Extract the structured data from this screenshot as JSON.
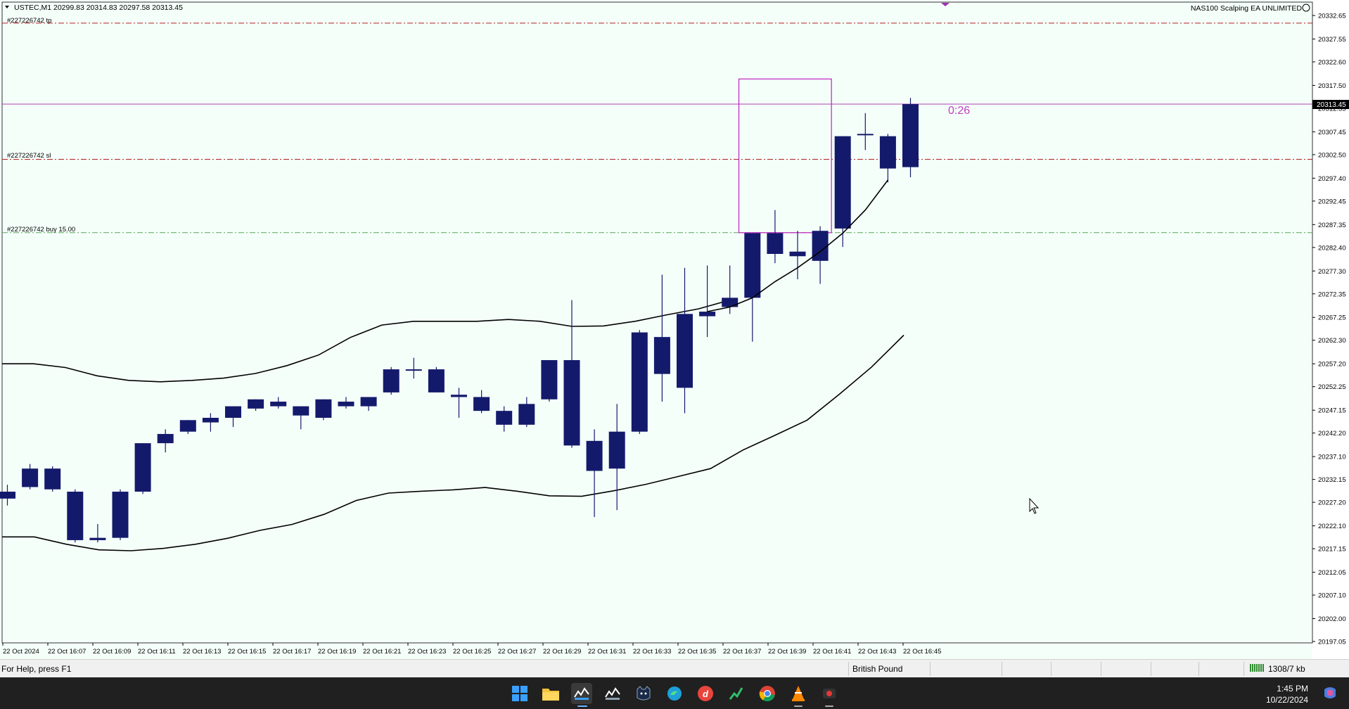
{
  "header": {
    "symbol_info": "USTEC,M1  20299.83 20314.83 20297.58 20313.45",
    "ea_name": "NAS100 Scalping EA UNLIMITED"
  },
  "trade_lines": {
    "tp_label": "#227226742 tp",
    "sl_label": "#227226742 sl",
    "buy_label": "#227226742 buy 15.00",
    "tp_price": 20331.0,
    "sl_price": 20301.5,
    "buy_price": 20285.6
  },
  "countdown": "0:26",
  "current_price": 20313.45,
  "current_price_label": "20313.45",
  "colors": {
    "candle": "#141a6b",
    "chart_bg": "#f5fffa",
    "sl_tp_line": "#b32020",
    "buy_line": "#5aa55a",
    "price_line": "#b040b0",
    "box": "#c020c0"
  },
  "price_axis": {
    "labels": [
      "20332.65",
      "20327.55",
      "20322.60",
      "20317.50",
      "20312.55",
      "20307.45",
      "20302.50",
      "20297.40",
      "20292.45",
      "20287.35",
      "20282.40",
      "20277.30",
      "20272.35",
      "20267.25",
      "20262.30",
      "20257.20",
      "20252.25",
      "20247.15",
      "20242.20",
      "20237.10",
      "20232.15",
      "20227.20",
      "20222.10",
      "20217.15",
      "20212.05",
      "20207.10",
      "20202.00",
      "20197.05"
    ]
  },
  "time_axis": {
    "labels": [
      "22 Oct 2024",
      "22 Oct 16:07",
      "22 Oct 16:09",
      "22 Oct 16:11",
      "22 Oct 16:13",
      "22 Oct 16:15",
      "22 Oct 16:17",
      "22 Oct 16:19",
      "22 Oct 16:21",
      "22 Oct 16:23",
      "22 Oct 16:25",
      "22 Oct 16:27",
      "22 Oct 16:29",
      "22 Oct 16:31",
      "22 Oct 16:33",
      "22 Oct 16:35",
      "22 Oct 16:37",
      "22 Oct 16:39",
      "22 Oct 16:41",
      "22 Oct 16:43",
      "22 Oct 16:45"
    ]
  },
  "chart_data": {
    "type": "candlestick",
    "x_start_minute": "16:05",
    "candles": [
      {
        "o": 20229.5,
        "h": 20231.0,
        "l": 20226.5,
        "c": 20228.0
      },
      {
        "o": 20230.5,
        "h": 20235.5,
        "l": 20230.0,
        "c": 20234.5
      },
      {
        "o": 20234.5,
        "h": 20235.0,
        "l": 20229.5,
        "c": 20230.0
      },
      {
        "o": 20229.5,
        "h": 20230.0,
        "l": 20218.5,
        "c": 20219.0
      },
      {
        "o": 20219.0,
        "h": 20222.5,
        "l": 20218.5,
        "c": 20219.5
      },
      {
        "o": 20219.5,
        "h": 20230.0,
        "l": 20219.0,
        "c": 20229.5
      },
      {
        "o": 20229.5,
        "h": 20240.0,
        "l": 20229.0,
        "c": 20240.0
      },
      {
        "o": 20240.0,
        "h": 20243.0,
        "l": 20238.0,
        "c": 20242.0
      },
      {
        "o": 20242.5,
        "h": 20245.0,
        "l": 20242.0,
        "c": 20245.0
      },
      {
        "o": 20244.5,
        "h": 20246.5,
        "l": 20242.5,
        "c": 20245.5
      },
      {
        "o": 20245.5,
        "h": 20248.0,
        "l": 20243.5,
        "c": 20248.0
      },
      {
        "o": 20247.5,
        "h": 20249.5,
        "l": 20247.0,
        "c": 20249.5
      },
      {
        "o": 20249.0,
        "h": 20250.0,
        "l": 20247.5,
        "c": 20248.0
      },
      {
        "o": 20246.0,
        "h": 20248.0,
        "l": 20243.0,
        "c": 20248.0
      },
      {
        "o": 20245.5,
        "h": 20249.5,
        "l": 20245.0,
        "c": 20249.5
      },
      {
        "o": 20248.0,
        "h": 20250.0,
        "l": 20247.5,
        "c": 20249.0
      },
      {
        "o": 20248.0,
        "h": 20250.0,
        "l": 20247.0,
        "c": 20250.0
      },
      {
        "o": 20251.0,
        "h": 20256.5,
        "l": 20250.5,
        "c": 20256.0
      },
      {
        "o": 20256.0,
        "h": 20258.5,
        "l": 20254.0,
        "c": 20256.0
      },
      {
        "o": 20256.0,
        "h": 20256.5,
        "l": 20251.0,
        "c": 20251.0
      },
      {
        "o": 20250.5,
        "h": 20252.0,
        "l": 20245.5,
        "c": 20250.0
      },
      {
        "o": 20250.0,
        "h": 20251.5,
        "l": 20246.5,
        "c": 20247.0
      },
      {
        "o": 20247.0,
        "h": 20248.0,
        "l": 20242.5,
        "c": 20244.0
      },
      {
        "o": 20244.0,
        "h": 20250.0,
        "l": 20243.5,
        "c": 20248.5
      },
      {
        "o": 20249.5,
        "h": 20258.0,
        "l": 20249.0,
        "c": 20258.0
      },
      {
        "o": 20258.0,
        "h": 20271.0,
        "l": 20239.0,
        "c": 20239.5
      },
      {
        "o": 20240.5,
        "h": 20243.0,
        "l": 20224.0,
        "c": 20234.0
      },
      {
        "o": 20234.5,
        "h": 20248.5,
        "l": 20225.5,
        "c": 20242.5
      },
      {
        "o": 20242.5,
        "h": 20264.5,
        "l": 20242.0,
        "c": 20264.0
      },
      {
        "o": 20263.0,
        "h": 20276.5,
        "l": 20249.0,
        "c": 20255.0
      },
      {
        "o": 20252.0,
        "h": 20278.0,
        "l": 20246.5,
        "c": 20268.0
      },
      {
        "o": 20267.5,
        "h": 20278.5,
        "l": 20263.0,
        "c": 20268.5
      },
      {
        "o": 20269.5,
        "h": 20278.5,
        "l": 20268.0,
        "c": 20271.5
      },
      {
        "o": 20271.5,
        "h": 20285.5,
        "l": 20262.0,
        "c": 20285.5
      },
      {
        "o": 20285.5,
        "h": 20290.5,
        "l": 20279.0,
        "c": 20281.0
      },
      {
        "o": 20281.5,
        "h": 20286.0,
        "l": 20275.5,
        "c": 20280.5
      },
      {
        "o": 20279.5,
        "h": 20287.0,
        "l": 20274.5,
        "c": 20286.0
      },
      {
        "o": 20286.5,
        "h": 20306.5,
        "l": 20282.5,
        "c": 20306.5
      },
      {
        "o": 20307.0,
        "h": 20311.5,
        "l": 20303.5,
        "c": 20307.0
      },
      {
        "o": 20299.5,
        "h": 20307.0,
        "l": 20296.5,
        "c": 20306.5
      },
      {
        "o": 20299.8,
        "h": 20314.8,
        "l": 20297.6,
        "c": 20313.45
      }
    ],
    "ma_line": [
      {
        "i": 31,
        "v": 20268.5
      },
      {
        "i": 32,
        "v": 20269.5
      },
      {
        "i": 33,
        "v": 20271.5
      },
      {
        "i": 34,
        "v": 20275.0
      },
      {
        "i": 35,
        "v": 20278.0
      },
      {
        "i": 36,
        "v": 20281.5
      },
      {
        "i": 37,
        "v": 20285.5
      },
      {
        "i": 38,
        "v": 20290.5
      },
      {
        "i": 39,
        "v": 20297.0
      }
    ],
    "bollinger_upper": [
      20257.2,
      20257.2,
      20256.4,
      20254.6,
      20253.6,
      20253.3,
      20253.6,
      20254.1,
      20255.1,
      20256.8,
      20259.1,
      20262.9,
      20265.6,
      20266.4,
      20266.4,
      20266.4,
      20266.8,
      20266.4,
      20265.3,
      20265.4,
      20266.4,
      20267.8,
      20269.1,
      20271.0
    ],
    "bollinger_lower": [
      20219.7,
      20219.7,
      20218.1,
      20216.9,
      20216.7,
      20217.2,
      20218.1,
      20219.4,
      20221.1,
      20222.4,
      20224.6,
      20227.6,
      20229.2,
      20229.6,
      20229.9,
      20230.4,
      20229.6,
      20228.6,
      20228.5,
      20229.7,
      20231.1,
      20232.8,
      20234.5,
      20238.5,
      20241.7,
      20245.0,
      20250.6,
      20256.5,
      20263.4
    ]
  },
  "status_bar": {
    "help": "For Help, press F1",
    "currency": "British Pound",
    "traffic": "1308/7 kb"
  },
  "taskbar": {
    "time": "1:45 PM",
    "date": "10/22/2024"
  }
}
